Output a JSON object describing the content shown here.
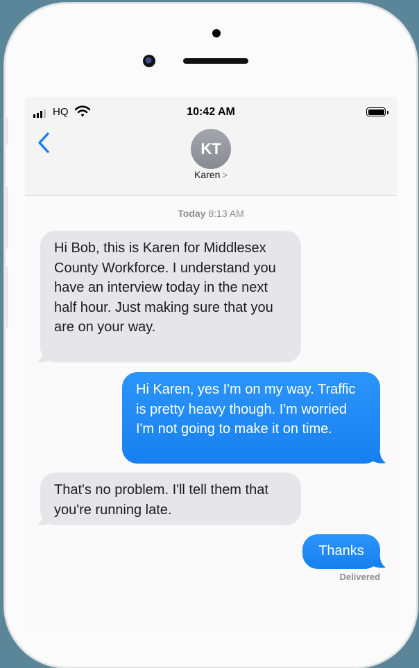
{
  "status_bar": {
    "carrier": "HQ",
    "time": "10:42 AM"
  },
  "header": {
    "avatar_initials": "KT",
    "contact_name": "Karen",
    "contact_chevron": ">"
  },
  "conversation": {
    "date_label": "Today",
    "time_label": "8:13 AM",
    "messages": [
      {
        "direction": "incoming",
        "text": "Hi Bob, this is Karen for Middlesex County Workforce. I understand you have an interview today in the next half hour. Just making sure that you are on your way."
      },
      {
        "direction": "outgoing",
        "text": "Hi Karen, yes I'm on my way. Traffic is pretty heavy though. I'm worried I'm not going to make it on time."
      },
      {
        "direction": "incoming",
        "text": "That's no problem. I'll tell them that you're running late."
      },
      {
        "direction": "outgoing",
        "text": "Thanks"
      }
    ],
    "delivery_status": "Delivered"
  },
  "colors": {
    "outgoing_bubble": "#1e8bf4",
    "incoming_bubble": "#e5e5ea",
    "accent": "#147efb",
    "background": "#5b8699"
  },
  "icons": [
    "signal-icon",
    "wifi-icon",
    "battery-icon",
    "back-chevron-icon"
  ]
}
